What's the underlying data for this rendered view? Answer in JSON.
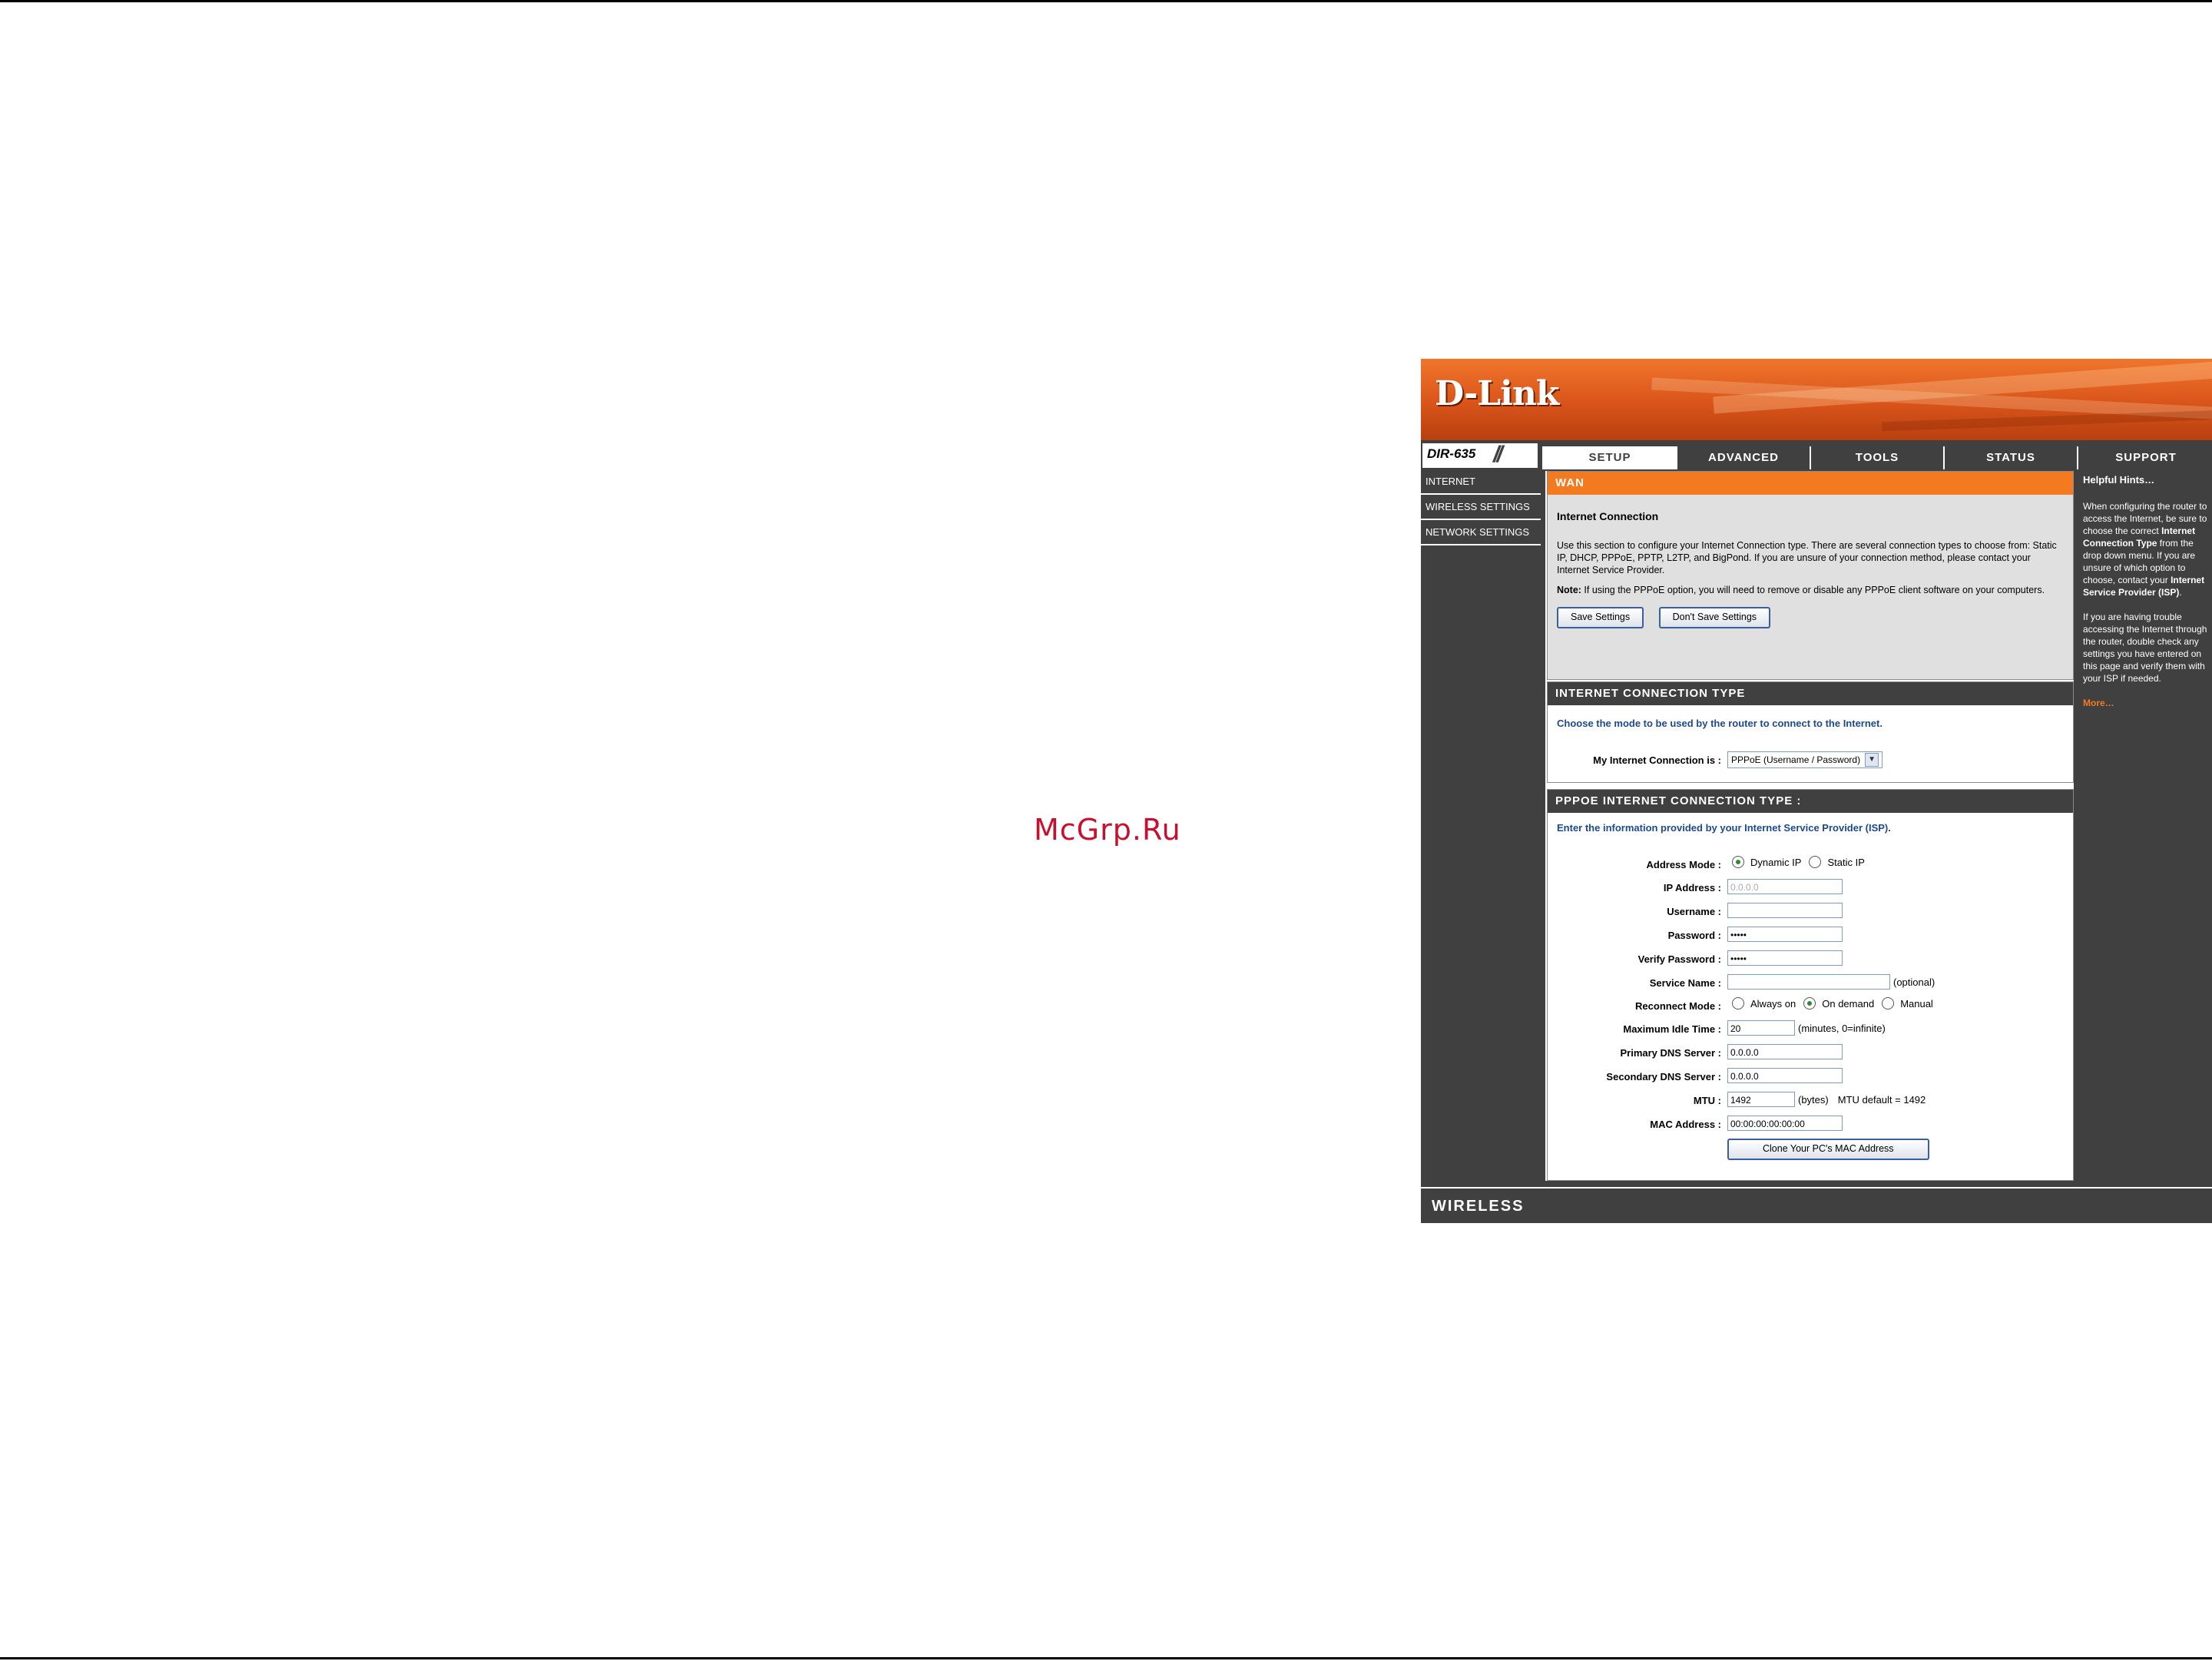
{
  "watermark": "McGrp.Ru",
  "router": {
    "logo": "D-Link",
    "model": "DIR-635",
    "tabs": [
      "SETUP",
      "ADVANCED",
      "TOOLS",
      "STATUS",
      "SUPPORT"
    ],
    "active_tab": "SETUP",
    "nav": [
      "INTERNET",
      "WIRELESS SETTINGS",
      "NETWORK SETTINGS"
    ],
    "wan": {
      "header": "WAN",
      "title": "Internet Connection",
      "description": "Use this section to configure your Internet Connection type. There are several connection types to choose from: Static IP, DHCP, PPPoE, PPTP, L2TP, and BigPond. If you are unsure of your connection method, please contact your Internet Service Provider.",
      "note_label": "Note:",
      "note_text": " If using the PPPoE option, you will need to remove or disable any PPPoE client software on your computers.",
      "save_label": "Save Settings",
      "dont_save_label": "Don't Save Settings"
    },
    "conn_type": {
      "header": "INTERNET CONNECTION TYPE",
      "prompt": "Choose the mode to be used by the router to connect to the Internet.",
      "label": "My Internet Connection is :",
      "selected": "PPPoE (Username / Password)"
    },
    "pppoe": {
      "header": "PPPOE INTERNET CONNECTION TYPE :",
      "prompt": "Enter the information provided by your Internet Service Provider (ISP).",
      "address_mode_label": "Address Mode :",
      "dynamic_ip": "Dynamic IP",
      "static_ip": "Static IP",
      "ip_label": "IP Address :",
      "ip_value": "0.0.0.0",
      "username_label": "Username :",
      "username_value": "",
      "password_label": "Password :",
      "password_value": "•••••",
      "verify_label": "Verify Password :",
      "verify_value": "•••••",
      "service_label": "Service Name :",
      "service_value": "",
      "service_hint": "(optional)",
      "reconnect_label": "Reconnect Mode :",
      "always_on": "Always on",
      "on_demand": "On demand",
      "manual": "Manual",
      "idle_label": "Maximum Idle Time :",
      "idle_value": "20",
      "idle_hint": "(minutes, 0=infinite)",
      "dns1_label": "Primary DNS Server :",
      "dns1_value": "0.0.0.0",
      "dns2_label": "Secondary DNS Server :",
      "dns2_value": "0.0.0.0",
      "mtu_label": "MTU :",
      "mtu_value": "1492",
      "mtu_unit": "(bytes)",
      "mtu_default": "MTU default = 1492",
      "mac_label": "MAC Address :",
      "mac_value": "00:00:00:00:00:00",
      "clone_label": "Clone Your PC's MAC Address"
    },
    "hints": {
      "title": "Helpful Hints…",
      "p1_a": "When configuring the router to access the Internet, be sure to choose the correct ",
      "p1_b": "Internet Connection Type",
      "p1_c": " from the drop down menu. If you are unsure of which option to choose, contact your ",
      "p1_d": "Internet Service Provider (ISP)",
      "p1_e": ".",
      "p2": "If you are having trouble accessing the Internet through the router, double check any settings you have entered on this page and verify them with your ISP if needed.",
      "more": "More…"
    },
    "footer": "WIRELESS"
  }
}
